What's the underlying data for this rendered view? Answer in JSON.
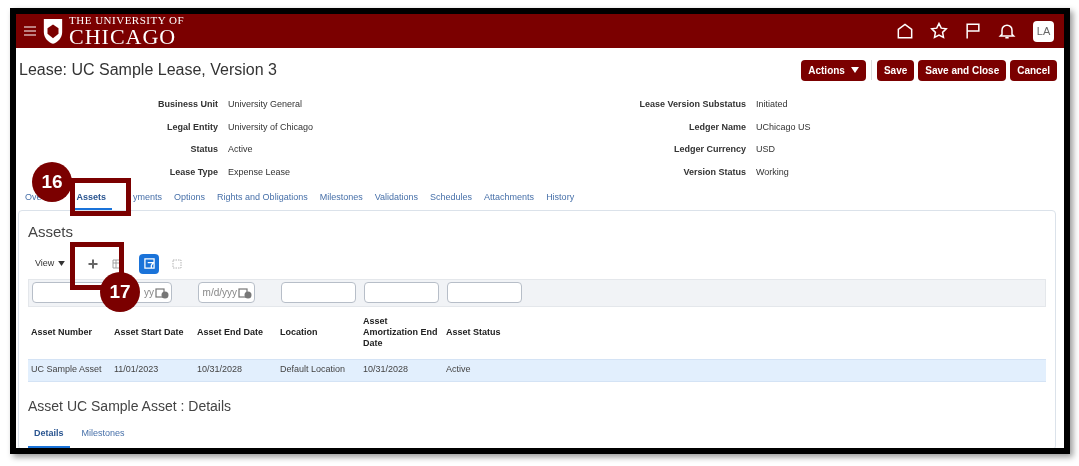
{
  "header": {
    "logo_top": "THE UNIVERSITY OF",
    "logo_bottom": "CHICAGO",
    "user_initials": "LA"
  },
  "page": {
    "title": "Lease: UC Sample Lease, Version 3",
    "buttons": [
      {
        "label": "Actions",
        "kind": "menu"
      },
      {
        "label": "Save",
        "kind": "plain"
      },
      {
        "label": "Save and Close",
        "kind": "plain"
      },
      {
        "label": "Cancel",
        "kind": "plain"
      }
    ]
  },
  "summary": {
    "left": [
      {
        "label": "Business Unit",
        "value": "University General"
      },
      {
        "label": "Legal Entity",
        "value": "University of Chicago"
      },
      {
        "label": "Status",
        "value": "Active"
      },
      {
        "label": "Lease Type",
        "value": "Expense Lease"
      }
    ],
    "right": [
      {
        "label": "Lease Version Substatus",
        "value": "Initiated"
      },
      {
        "label": "Ledger Name",
        "value": "UChicago US"
      },
      {
        "label": "Ledger Currency",
        "value": "USD"
      },
      {
        "label": "Version Status",
        "value": "Working"
      }
    ]
  },
  "tabs": [
    {
      "label": "Ove",
      "selected": false
    },
    {
      "label": "Assets",
      "selected": true
    },
    {
      "label": "yments",
      "selected": false
    },
    {
      "label": "Options",
      "selected": false
    },
    {
      "label": "Rights and Obligations",
      "selected": false
    },
    {
      "label": "Milestones",
      "selected": false
    },
    {
      "label": "Validations",
      "selected": false
    },
    {
      "label": "Schedules",
      "selected": false
    },
    {
      "label": "Attachments",
      "selected": false
    },
    {
      "label": "History",
      "selected": false
    }
  ],
  "assets": {
    "heading": "Assets",
    "view_label": "View",
    "filters": [
      {
        "kind": "text"
      },
      {
        "kind": "date",
        "placeholder": "yy"
      },
      {
        "kind": "date",
        "placeholder": "m/d/yyy"
      },
      {
        "kind": "text"
      },
      {
        "kind": "text"
      },
      {
        "kind": "text"
      }
    ],
    "columns": [
      "Asset Number",
      "Asset Start Date",
      "Asset End Date",
      "Location",
      "Asset Amortization End Date",
      "Asset Status"
    ],
    "rows": [
      {
        "cells": [
          "UC Sample Asset",
          "11/01/2023",
          "10/31/2028",
          "Default Location",
          "10/31/2028",
          "Active"
        ],
        "selected": true
      }
    ]
  },
  "details": {
    "heading": "Asset UC Sample Asset : Details",
    "tabs": [
      {
        "label": "Details",
        "selected": true
      },
      {
        "label": "Milestones",
        "selected": false
      }
    ]
  },
  "callouts": [
    {
      "number": "16"
    },
    {
      "number": "17"
    }
  ]
}
